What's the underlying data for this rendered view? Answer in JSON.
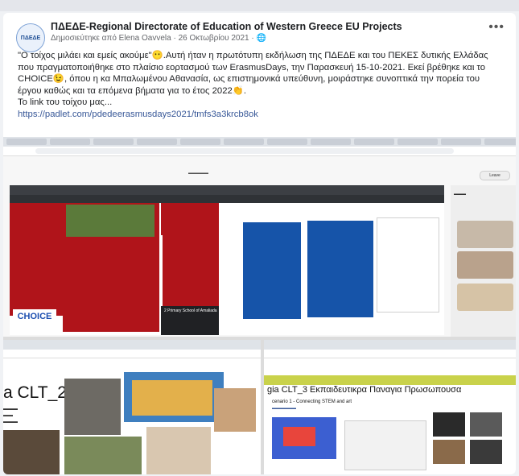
{
  "post": {
    "page_name": "ΠΔΕΔΕ-Regional Directorate of Education of Western Greece EU Projects",
    "avatar_text": "ΠΔΕΔΕ",
    "meta": "Δημοσιεύτηκε από Elena Oavvela · 26 Οκτωβρίου 2021 ·",
    "paragraph_1": "\"Ο τοίχος μιλάει και εμείς ακούμε\"😶.Αυτή ήταν η πρωτότυπη εκδήλωση της ΠΔΕΔΕ και του ΠΕΚΕΣ δυτικής Ελλάδας που πραγματοποιήθηκε στο πλαίσιο εορτασμού των ErasmusDays, την Παρασκευή 15-10-2021. Εκεί βρέθηκε και το CHOICE😉, όπου η κα Μπαλωμένου Αθανασία, ως επιστημονικά υπεύθυνη, μοιράστηκε συνοπτικά την πορεία του έργου καθώς και τα επόμενα βήματα για το έτος 2022👏.",
    "paragraph_2": "Το link του τοίχου μας...",
    "link": "https://padlet.com/pdedeerasmusdays2021/tmfs3a3krcb8ok"
  },
  "collage": {
    "choice_logo": "CHOICE",
    "dark_card_label": "2 Primary School of Amaliada",
    "leave_label": "Leave",
    "bottom_left_title": "a CLT_2",
    "bottom_right_title": "gia CLT_3 Εκπαιδευτικρα Παναγια Πρωσωπουσα",
    "bottom_right_subtitle": "cenario 1 - Connecting STEM and art"
  },
  "colors": {
    "accent": "#385898",
    "padlet_red": "#b0141a",
    "padlet_blue": "#1654a9"
  }
}
